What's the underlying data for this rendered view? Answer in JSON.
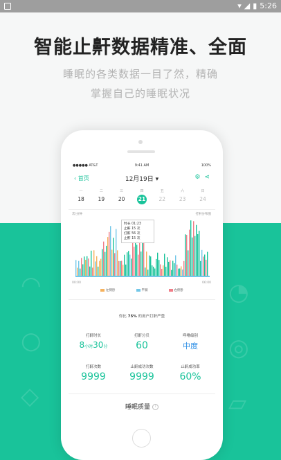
{
  "status_bar": {
    "time": "5:26",
    "wifi_icon": "wifi-icon",
    "signal_icon": "signal-icon",
    "battery_icon": "battery-icon"
  },
  "headline": "智能止鼾数据精准、全面",
  "subtitle_line1": "睡眠的各类数据一目了然，精确",
  "subtitle_line2": "掌握自己的睡眠状况",
  "phone_screen": {
    "status": {
      "carrier": "●●●●● AT&T",
      "time": "9:41 AM",
      "battery": "100%"
    },
    "nav": {
      "back_label": "首页",
      "date_title": "12月19日",
      "gear_icon": "gear-icon",
      "share_icon": "share-icon"
    },
    "week": {
      "weekdays": [
        "一",
        "二",
        "三",
        "四",
        "五",
        "六",
        "日"
      ],
      "days": [
        "18",
        "19",
        "20",
        "21",
        "22",
        "23",
        "24"
      ],
      "selected_index": 3
    },
    "chart": {
      "y_label": "次/分钟",
      "title": "打鼾分布图",
      "x_start": "00:00",
      "x_end": "06:00",
      "tooltip": {
        "line1": "时长 01:23",
        "line2": "止鼾 15 次",
        "line3": "打鼾 56 次",
        "line4": "止鼾 15 次"
      },
      "legend": [
        {
          "label": "左侧卧",
          "color": "#f5b25e"
        },
        {
          "label": "平躺",
          "color": "#72c7e8"
        },
        {
          "label": "右侧卧",
          "color": "#f07e88"
        }
      ]
    },
    "comparison": {
      "prefix": "你比",
      "percent": "75%",
      "suffix": "的用户打鼾严重"
    },
    "stats": [
      {
        "key": "打鼾时长",
        "value_h": "8",
        "unit_h": "小时",
        "value_m": "30",
        "unit_m": "分"
      },
      {
        "key": "打鼾分贝",
        "value": "60"
      },
      {
        "key": "呼噜级别",
        "value": "中度"
      },
      {
        "key": "打鼾次数",
        "value": "9999"
      },
      {
        "key": "止鼾成功次数",
        "value": "9999"
      },
      {
        "key": "止鼾成功率",
        "value": "60%"
      }
    ],
    "quality_label": "睡眠质量"
  }
}
